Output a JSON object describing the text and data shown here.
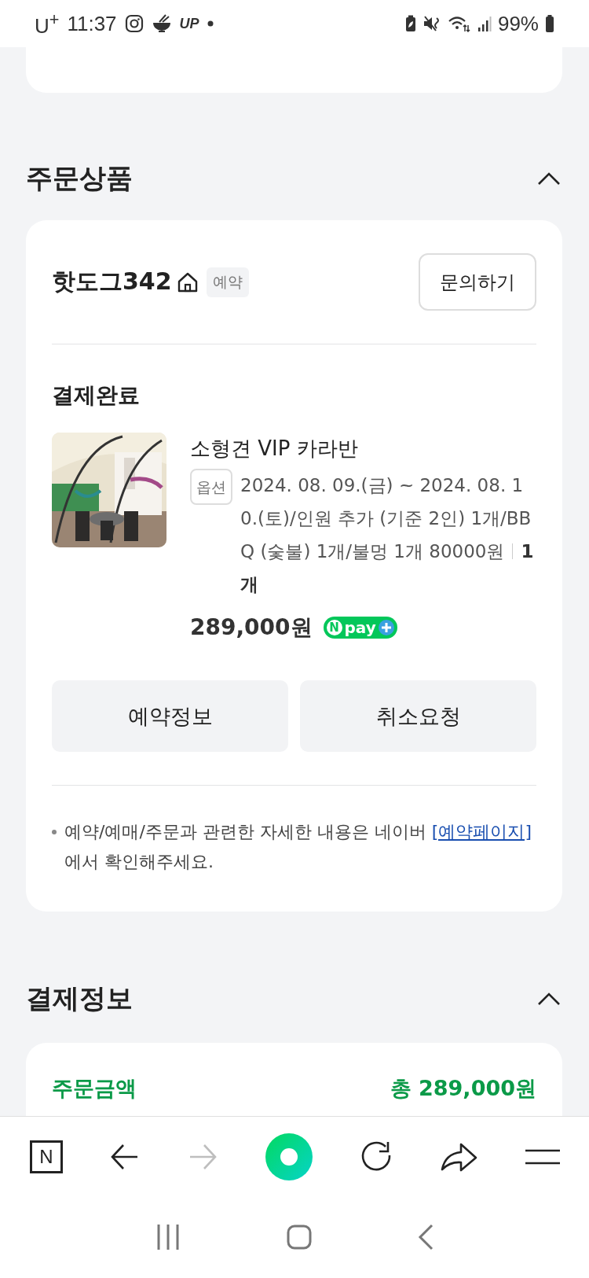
{
  "status_bar": {
    "carrier": "U$^{+}$",
    "time": "11:37",
    "app_logo": "UP",
    "battery": "99%"
  },
  "order_section": {
    "title": "주문상품",
    "expanded": true,
    "store": {
      "name": "핫도그342",
      "tag": "예약",
      "inquiry_button": "문의하기"
    },
    "status": "결제완료",
    "product": {
      "name": "소형견 VIP 카라반",
      "option_label": "옵션",
      "option": "2024. 08. 09.(금) ~ 2024. 08. 10.(토)/인원 추가 (기준 2인) 1개/BBQ (숯불) 1개/불멍 1개 80000원",
      "quantity": "1개",
      "price": "289,000원",
      "pay_badge": {
        "mark": "N",
        "label": "pay"
      }
    },
    "buttons": [
      "예약정보",
      "취소요청"
    ],
    "note": {
      "text": "예약/예매/주문과 관련한 자세한 내용은 네이버 ",
      "link": "[예약페이지]",
      "suffix": "에서 확인해주세요."
    }
  },
  "payment_section": {
    "title": "결제정보",
    "expanded": true,
    "total_label": "주문금액",
    "total": "총 289,000원"
  },
  "toolbar": [
    {
      "kind": "home",
      "label": "N",
      "disabled": false
    },
    {
      "kind": "back",
      "disabled": false
    },
    {
      "kind": "forward",
      "disabled": true
    },
    {
      "kind": "green",
      "disabled": false
    },
    {
      "kind": "reload",
      "disabled": false
    },
    {
      "kind": "share",
      "disabled": false
    },
    {
      "kind": "menu",
      "disabled": false
    }
  ]
}
